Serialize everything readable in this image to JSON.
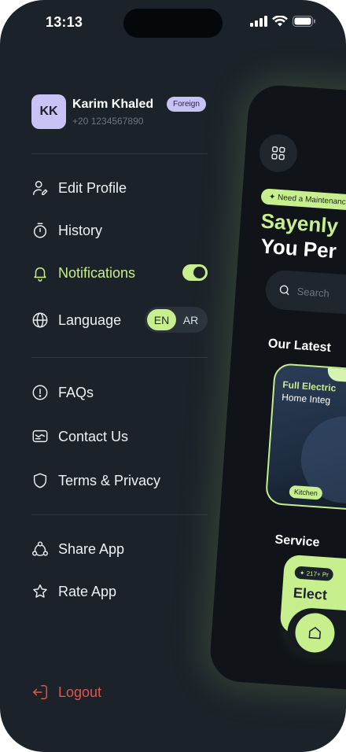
{
  "status_bar": {
    "time": "13:13"
  },
  "profile": {
    "initials": "KK",
    "name": "Karim Khaled",
    "phone": "+20 1234567890",
    "badge": "Foreign"
  },
  "menu": {
    "edit_profile": "Edit Profile",
    "history": "History",
    "notifications": "Notifications",
    "notifications_enabled": true,
    "language": "Language",
    "language_options": [
      "EN",
      "AR"
    ],
    "language_selected": "EN",
    "faqs": "FAQs",
    "contact_us": "Contact Us",
    "terms_privacy": "Terms & Privacy",
    "share_app": "Share App",
    "rate_app": "Rate App",
    "logout": "Logout"
  },
  "preview": {
    "chip": "✦ Need a Maintenanc",
    "title_line1": "Sayenly",
    "title_line2": "You Per",
    "search_placeholder": "Search",
    "latest_heading": "Our Latest",
    "card_title1": "Full Electric",
    "card_title2": "Home Integ",
    "card_tag": "Kitchen",
    "services_heading": "Service",
    "service_chip": "✦ 217+ Pr",
    "service_title": "Elect"
  },
  "colors": {
    "accent": "#c7ef8e",
    "background": "#1b2229",
    "danger": "#e0564e",
    "badge": "#c9c3f5"
  }
}
